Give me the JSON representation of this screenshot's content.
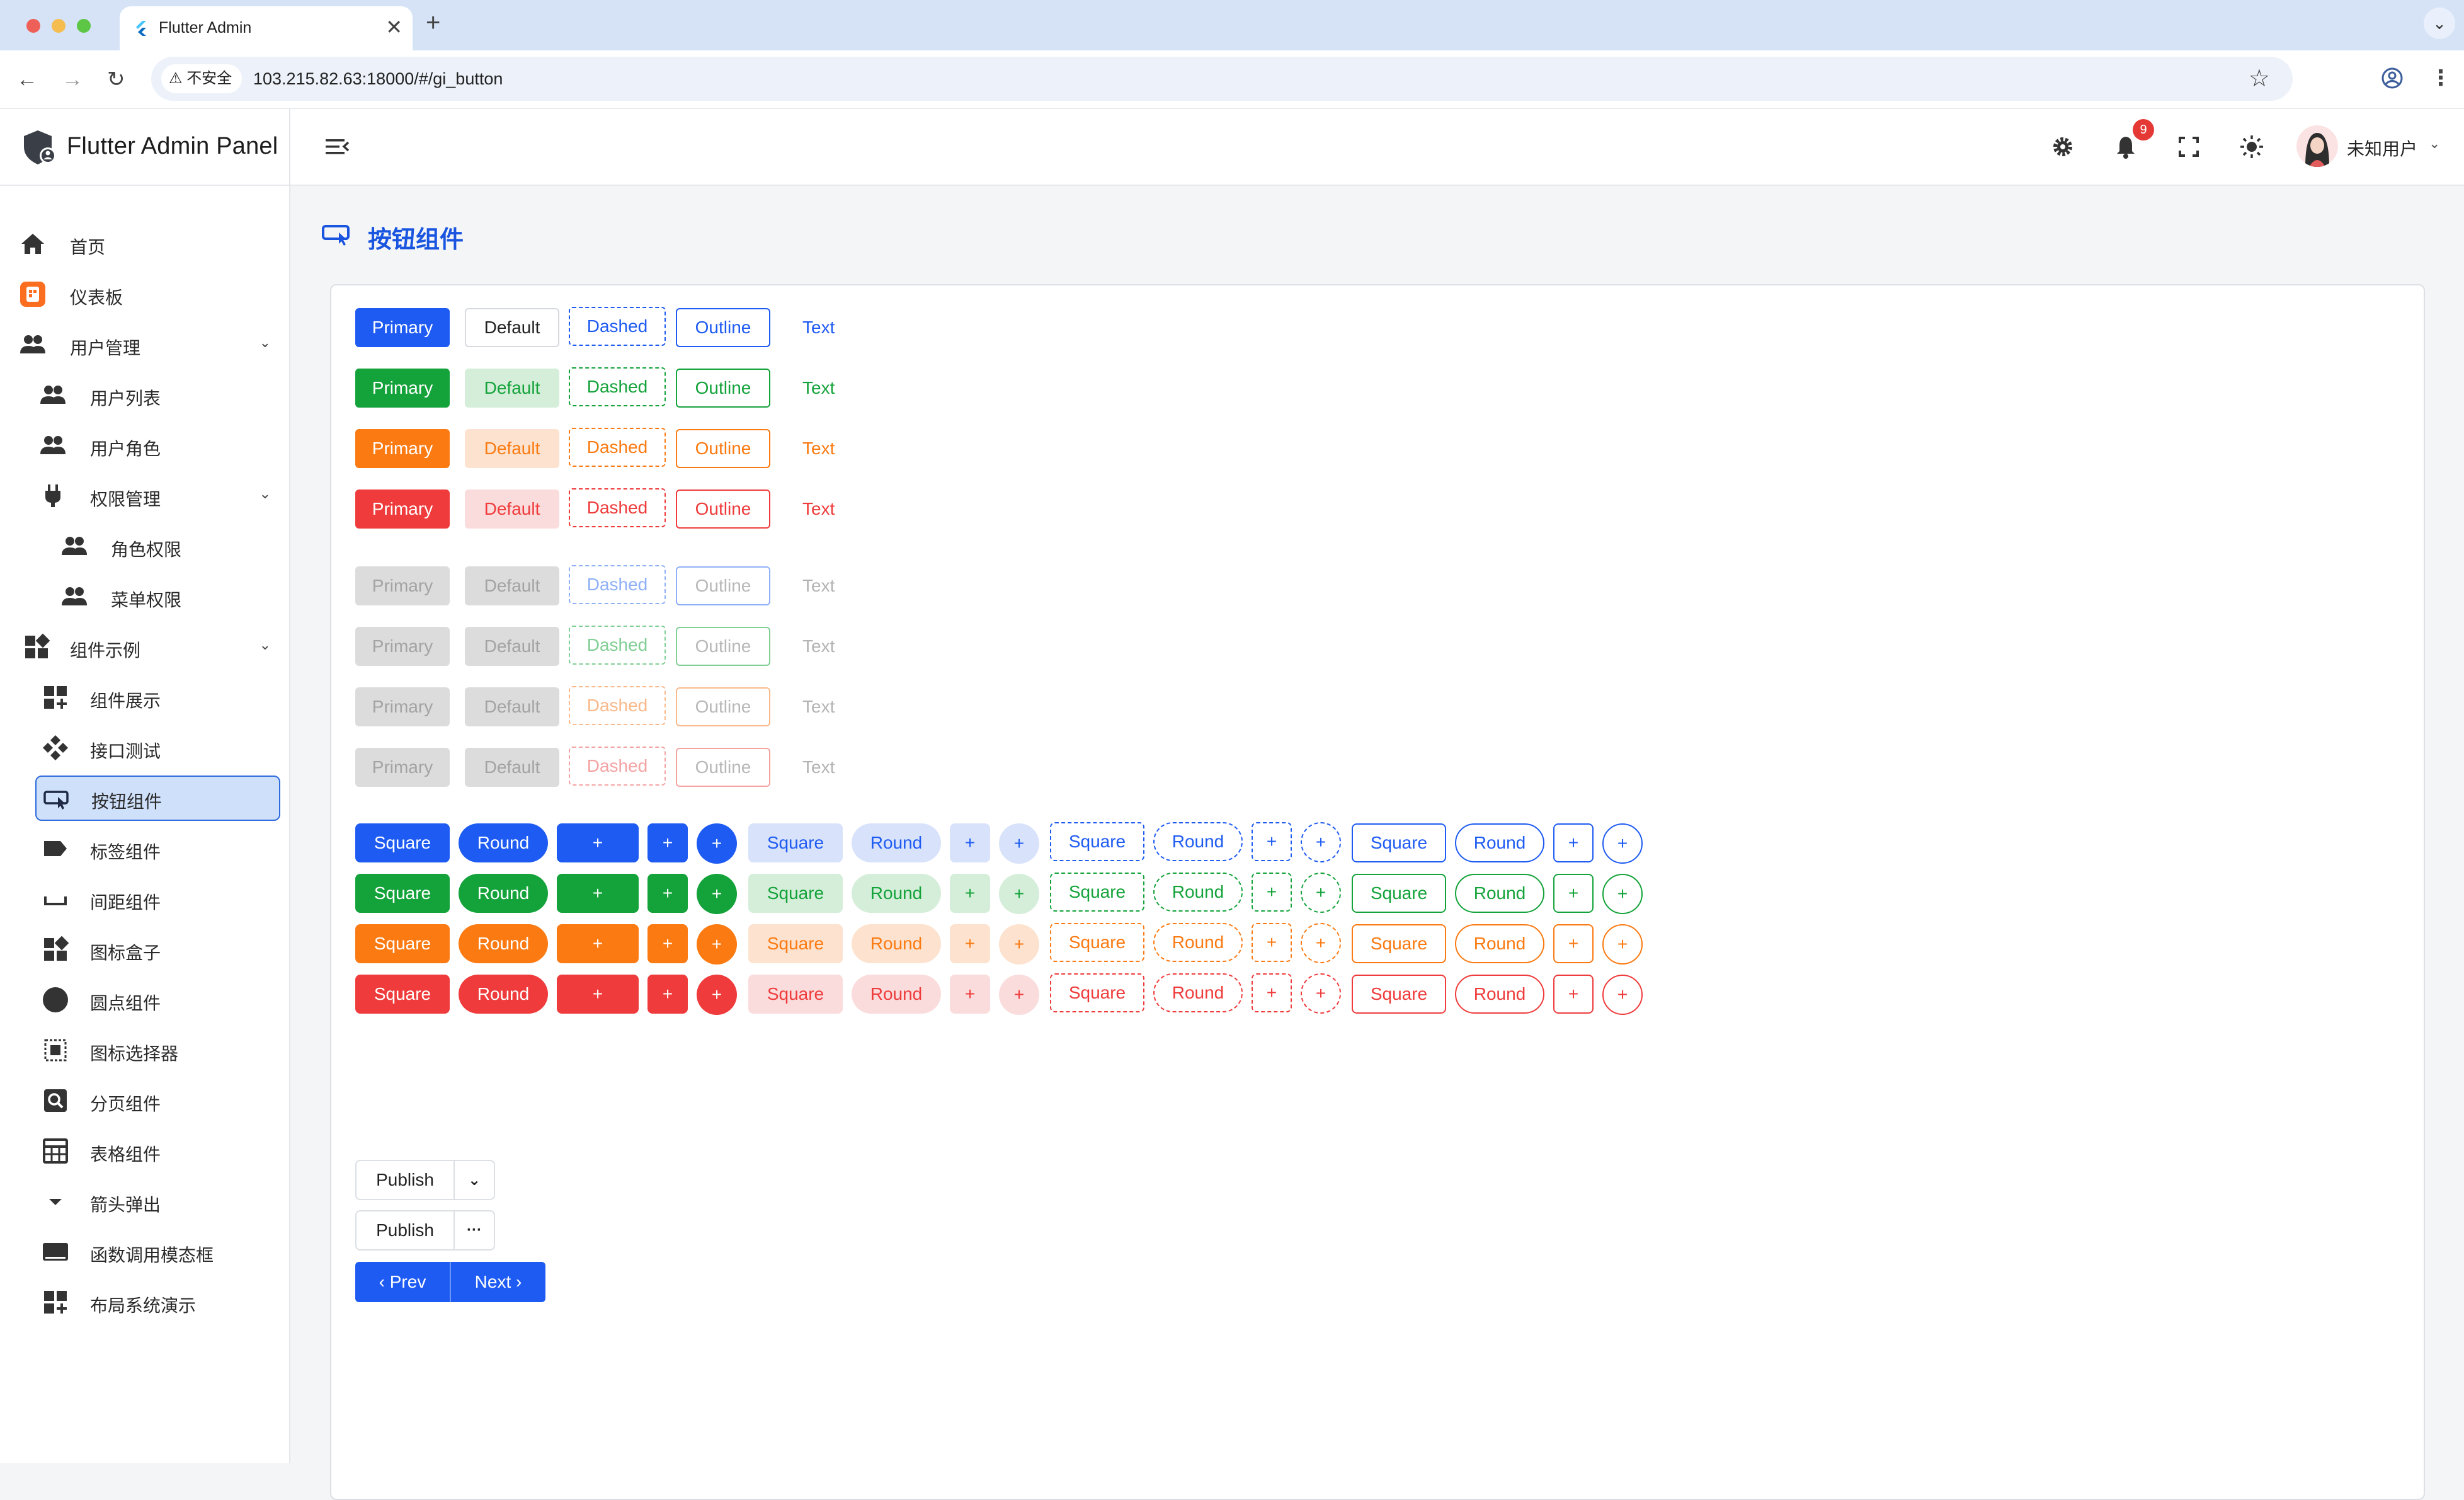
{
  "browser": {
    "tab_title": "Flutter Admin",
    "tab_close": "✕",
    "new_tab": "+",
    "security_label": "不安全",
    "url": "103.215.82.63:18000/#/gi_button"
  },
  "app": {
    "brand_title": "Flutter Admin Panel",
    "page_title": "按钮组件",
    "username": "未知用户",
    "notification_count": "9"
  },
  "sidebar": {
    "items": [
      {
        "label": "首页",
        "icon": "home-icon"
      },
      {
        "label": "仪表板",
        "icon": "dashboard-icon"
      },
      {
        "label": "用户管理",
        "icon": "people-icon",
        "expanded": true
      },
      {
        "label": "用户列表",
        "icon": "people-icon"
      },
      {
        "label": "用户角色",
        "icon": "people-icon"
      },
      {
        "label": "权限管理",
        "icon": "plug-icon",
        "expanded": true
      },
      {
        "label": "角色权限",
        "icon": "people-icon"
      },
      {
        "label": "菜单权限",
        "icon": "people-icon"
      },
      {
        "label": "组件示例",
        "icon": "widgets-icon",
        "expanded": true
      },
      {
        "label": "组件展示",
        "icon": "widgets-add-icon"
      },
      {
        "label": "接口测试",
        "icon": "api-icon"
      },
      {
        "label": "按钮组件",
        "icon": "button-icon",
        "active": true
      },
      {
        "label": "标签组件",
        "icon": "label-icon"
      },
      {
        "label": "间距组件",
        "icon": "space-bar-icon"
      },
      {
        "label": "图标盒子",
        "icon": "widgets-icon"
      },
      {
        "label": "圆点组件",
        "icon": "circle-icon"
      },
      {
        "label": "图标选择器",
        "icon": "select-all-icon"
      },
      {
        "label": "分页组件",
        "icon": "search-box-icon"
      },
      {
        "label": "表格组件",
        "icon": "table-icon"
      },
      {
        "label": "箭头弹出",
        "icon": "arrow-drop-down-icon"
      },
      {
        "label": "函数调用模态框",
        "icon": "window-icon"
      },
      {
        "label": "布局系统演示",
        "icon": "widgets-add-icon"
      }
    ]
  },
  "theme": {
    "colors": {
      "blue": {
        "solid": "#1e5bf2",
        "light": "#d8e3fb",
        "text": "#1e5bf2",
        "disabled": "#8fb0f6"
      },
      "green": {
        "solid": "#14a33a",
        "light": "#d5eed9",
        "text": "#14a33a",
        "disabled": "#80cf94"
      },
      "orange": {
        "solid": "#fb7a12",
        "light": "#fde3cf",
        "text": "#fb7a12",
        "disabled": "#f9b98a"
      },
      "red": {
        "solid": "#ef3b3b",
        "light": "#fbdcdc",
        "text": "#ef3b3b",
        "disabled": "#f4a3a3"
      }
    }
  },
  "button_labels": {
    "primary": "Primary",
    "default": "Default",
    "dashed": "Dashed",
    "outline": "Outline",
    "text": "Text",
    "square": "Square",
    "round": "Round",
    "plus": "+"
  },
  "split_buttons": [
    {
      "label": "Publish",
      "arrow": "⌄"
    },
    {
      "label": "Publish",
      "arrow": "···"
    }
  ],
  "pager": {
    "prev": "‹ Prev",
    "next": "Next ›"
  }
}
